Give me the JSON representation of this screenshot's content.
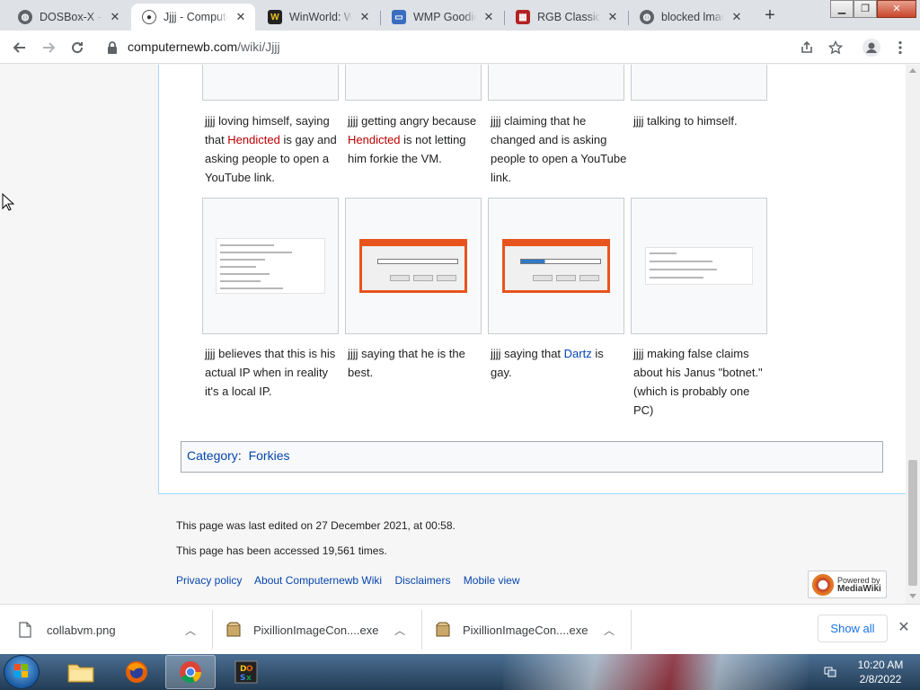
{
  "browser": {
    "tabs": [
      {
        "title": "DOSBox-X - A",
        "icon": "globe-icon",
        "active": false
      },
      {
        "title": "Jjjj - Compute",
        "icon": "wiki-icon",
        "active": true
      },
      {
        "title": "WinWorld: Wi",
        "icon": "winworld-icon",
        "active": false
      },
      {
        "title": "WMP Goodies",
        "icon": "window-icon",
        "active": false
      },
      {
        "title": "RGB Classic G",
        "icon": "rgb-icon",
        "active": false
      },
      {
        "title": "blocked lmao",
        "icon": "globe-icon",
        "active": false
      }
    ],
    "url_domain": "computernewb.com",
    "url_path": "/wiki/Jjjj"
  },
  "gallery_row1": [
    {
      "caption_parts": [
        "jjjj loving himself, saying that ",
        "Hendicted",
        " is gay and asking people to open a YouTube link."
      ]
    },
    {
      "caption_parts": [
        "jjjj getting angry because ",
        "Hendicted",
        " is not letting him forkie the VM."
      ]
    },
    {
      "caption": "jjjj claiming that he changed and is asking people to open a YouTube link."
    },
    {
      "caption": "jjjj talking to himself."
    }
  ],
  "gallery_row2": [
    {
      "caption": "jjjj believes that this is his actual IP when in reality it's a local IP."
    },
    {
      "caption": "jjjj saying that he is the best."
    },
    {
      "caption_parts": [
        "jjjj saying that ",
        "Dartz",
        " is gay."
      ]
    },
    {
      "caption": "jjjj making false claims about his Janus \"botnet.\" (which is probably one PC)"
    }
  ],
  "category": {
    "label": "Category",
    "link": "Forkies"
  },
  "footer": {
    "last_edited": "This page was last edited on 27 December 2021, at 00:58.",
    "accessed": "This page has been accessed 19,561 times.",
    "links": [
      "Privacy policy",
      "About Computernewb Wiki",
      "Disclaimers",
      "Mobile view"
    ],
    "powered_line1": "Powered by",
    "powered_line2": "MediaWiki"
  },
  "downloads": {
    "items": [
      {
        "name": "collabvm.png",
        "icon": "file-icon"
      },
      {
        "name": "PixillionImageCon....exe",
        "icon": "installer-icon"
      },
      {
        "name": "PixillionImageCon....exe",
        "icon": "installer-icon"
      }
    ],
    "show_all": "Show all"
  },
  "taskbar": {
    "time": "10:20 AM",
    "date": "2/8/2022"
  },
  "colors": {
    "link": "#0645ad",
    "redlink": "#ba0000",
    "chrome_tabstrip": "#dee1e6"
  }
}
